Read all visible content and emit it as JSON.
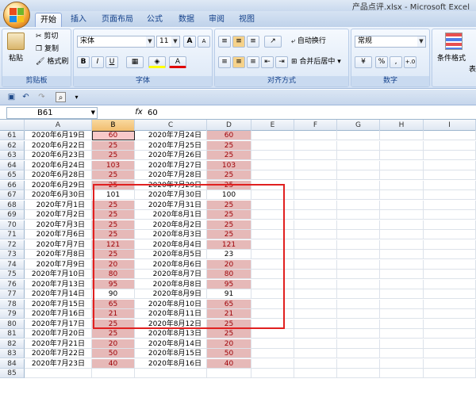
{
  "window": {
    "title": "产品点评.xlsx - Microsoft Excel"
  },
  "tabs": [
    {
      "label": "开始",
      "active": true
    },
    {
      "label": "插入"
    },
    {
      "label": "页面布局"
    },
    {
      "label": "公式"
    },
    {
      "label": "数据"
    },
    {
      "label": "审阅"
    },
    {
      "label": "视图"
    }
  ],
  "ribbon": {
    "clipboard": {
      "paste": "粘贴",
      "cut": "剪切",
      "copy": "复制",
      "format_painter": "格式刷",
      "label": "剪贴板"
    },
    "font": {
      "name": "宋体",
      "size": "11",
      "grow": "A",
      "shrink": "A",
      "bold": "B",
      "italic": "I",
      "underline": "U",
      "label": "字体"
    },
    "alignment": {
      "wrap": "自动换行",
      "merge": "合并后居中",
      "label": "对齐方式"
    },
    "number": {
      "format": "常规",
      "percent": "%",
      "comma": ",",
      "label": "数字"
    },
    "styles": {
      "conditional": "条件格式",
      "table": "表"
    }
  },
  "formula_bar": {
    "cell": "B61",
    "fx": "fx",
    "value": "60"
  },
  "columns": [
    "A",
    "B",
    "C",
    "D",
    "E",
    "F",
    "G",
    "H",
    "I"
  ],
  "rows": [
    {
      "n": "61",
      "a": "2020年6月19日",
      "b": "60",
      "c": "2020年7月24日",
      "d": "60",
      "b_hl": true,
      "d_hl": true
    },
    {
      "n": "62",
      "a": "2020年6月22日",
      "b": "25",
      "c": "2020年7月25日",
      "d": "25",
      "b_hl": true,
      "d_hl": true
    },
    {
      "n": "63",
      "a": "2020年6月23日",
      "b": "25",
      "c": "2020年7月26日",
      "d": "25",
      "b_hl": true,
      "d_hl": true
    },
    {
      "n": "64",
      "a": "2020年6月24日",
      "b": "103",
      "c": "2020年7月27日",
      "d": "103",
      "b_hl": true,
      "d_hl": true
    },
    {
      "n": "65",
      "a": "2020年6月28日",
      "b": "25",
      "c": "2020年7月28日",
      "d": "25",
      "b_hl": true,
      "d_hl": true
    },
    {
      "n": "66",
      "a": "2020年6月29日",
      "b": "25",
      "c": "2020年7月29日",
      "d": "25",
      "b_hl": true,
      "d_hl": true
    },
    {
      "n": "67",
      "a": "2020年6月30日",
      "b": "101",
      "c": "2020年7月30日",
      "d": "100",
      "b_hl": false,
      "d_hl": false
    },
    {
      "n": "68",
      "a": "2020年7月1日",
      "b": "25",
      "c": "2020年7月31日",
      "d": "25",
      "b_hl": true,
      "d_hl": true
    },
    {
      "n": "69",
      "a": "2020年7月2日",
      "b": "25",
      "c": "2020年8月1日",
      "d": "25",
      "b_hl": true,
      "d_hl": true
    },
    {
      "n": "70",
      "a": "2020年7月3日",
      "b": "25",
      "c": "2020年8月2日",
      "d": "25",
      "b_hl": true,
      "d_hl": true
    },
    {
      "n": "71",
      "a": "2020年7月6日",
      "b": "25",
      "c": "2020年8月3日",
      "d": "25",
      "b_hl": true,
      "d_hl": true
    },
    {
      "n": "72",
      "a": "2020年7月7日",
      "b": "121",
      "c": "2020年8月4日",
      "d": "121",
      "b_hl": true,
      "d_hl": true
    },
    {
      "n": "73",
      "a": "2020年7月8日",
      "b": "25",
      "c": "2020年8月5日",
      "d": "23",
      "b_hl": true,
      "d_hl": false
    },
    {
      "n": "74",
      "a": "2020年7月9日",
      "b": "20",
      "c": "2020年8月6日",
      "d": "20",
      "b_hl": true,
      "d_hl": true
    },
    {
      "n": "75",
      "a": "2020年7月10日",
      "b": "80",
      "c": "2020年8月7日",
      "d": "80",
      "b_hl": true,
      "d_hl": true
    },
    {
      "n": "76",
      "a": "2020年7月13日",
      "b": "95",
      "c": "2020年8月8日",
      "d": "95",
      "b_hl": true,
      "d_hl": true
    },
    {
      "n": "77",
      "a": "2020年7月14日",
      "b": "90",
      "c": "2020年8月9日",
      "d": "91",
      "b_hl": false,
      "d_hl": false
    },
    {
      "n": "78",
      "a": "2020年7月15日",
      "b": "65",
      "c": "2020年8月10日",
      "d": "65",
      "b_hl": true,
      "d_hl": true
    },
    {
      "n": "79",
      "a": "2020年7月16日",
      "b": "21",
      "c": "2020年8月11日",
      "d": "21",
      "b_hl": true,
      "d_hl": true
    },
    {
      "n": "80",
      "a": "2020年7月17日",
      "b": "25",
      "c": "2020年8月12日",
      "d": "25",
      "b_hl": true,
      "d_hl": true
    },
    {
      "n": "81",
      "a": "2020年7月20日",
      "b": "25",
      "c": "2020年8月13日",
      "d": "25",
      "b_hl": true,
      "d_hl": true
    },
    {
      "n": "82",
      "a": "2020年7月21日",
      "b": "20",
      "c": "2020年8月14日",
      "d": "20",
      "b_hl": true,
      "d_hl": true
    },
    {
      "n": "83",
      "a": "2020年7月22日",
      "b": "50",
      "c": "2020年8月15日",
      "d": "50",
      "b_hl": true,
      "d_hl": true
    },
    {
      "n": "84",
      "a": "2020年7月23日",
      "b": "40",
      "c": "2020年8月16日",
      "d": "40",
      "b_hl": true,
      "d_hl": true
    },
    {
      "n": "85",
      "a": "",
      "b": "",
      "c": "",
      "d": "",
      "b_hl": false,
      "d_hl": false
    }
  ],
  "colors": {
    "highlight_fill": "#e6b9b8",
    "highlight_text": "#9c0006",
    "annotation": "#e02020"
  }
}
